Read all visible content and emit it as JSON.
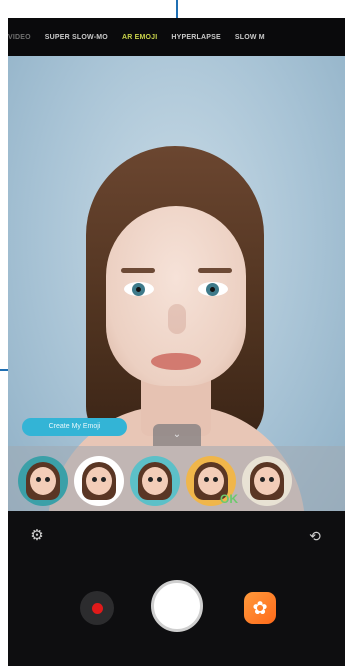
{
  "modes": [
    "VIDEO",
    "SUPER SLOW-MO",
    "AR EMOJI",
    "HYPERLAPSE",
    "SLOW M"
  ],
  "active_mode_index": 2,
  "ar": {
    "tooltip": "Create My Emoji",
    "handle_glyph": "⌄"
  },
  "emojis": [
    {
      "name": "my-emoji-1",
      "bg": "#3ba0a8"
    },
    {
      "name": "my-emoji-2",
      "bg": "#ffffff"
    },
    {
      "name": "my-emoji-3",
      "bg": "#5cc0c8"
    },
    {
      "name": "my-emoji-4",
      "bg": "#f0b64a",
      "badge": "OK"
    },
    {
      "name": "my-emoji-5",
      "bg": "#e8e2d4"
    }
  ],
  "categories": [
    {
      "icon": "history-icon",
      "glyph": "◷"
    },
    {
      "icon": "avatar-icon",
      "glyph": "♀",
      "active": true
    },
    {
      "icon": "sticker-icon",
      "glyph": "♣"
    },
    {
      "icon": "mask-icon",
      "glyph": "☗"
    },
    {
      "icon": "heart-icon",
      "glyph": "♡"
    },
    {
      "icon": "gallery-icon",
      "glyph": "⊡"
    },
    {
      "icon": "add-icon",
      "glyph": "+"
    }
  ],
  "controls": {
    "settings_glyph": "⚙",
    "switch_camera_glyph": "⟲",
    "effects_glyph": "✿"
  },
  "colors": {
    "accent": "#c8d24a",
    "tooltip": "#33b4d6",
    "record": "#e01a1a",
    "effects": "#ff7a2a"
  }
}
